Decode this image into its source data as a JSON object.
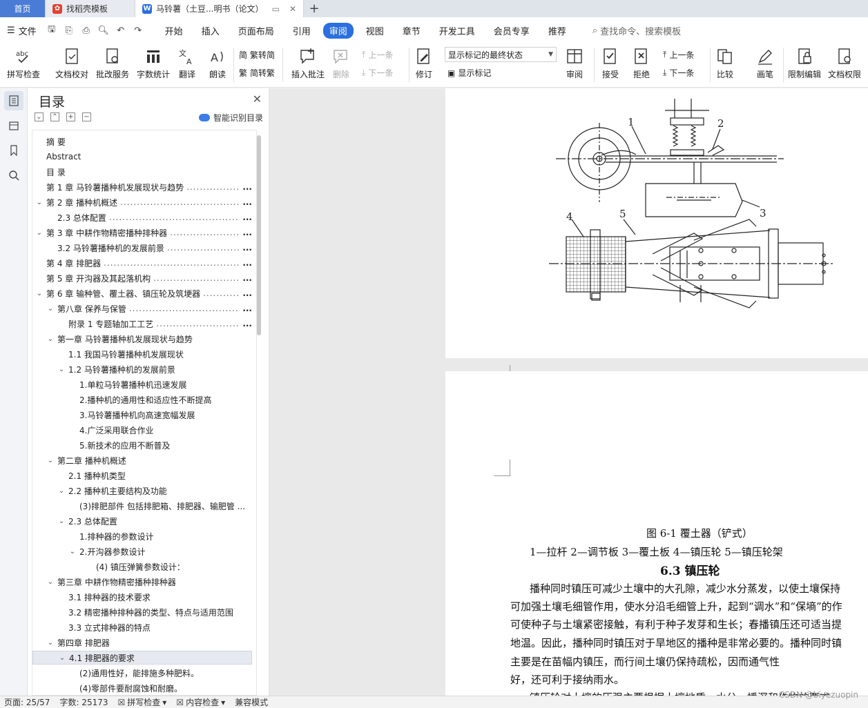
{
  "tabs": [
    {
      "label": "首页"
    },
    {
      "label": "找稻壳模板"
    },
    {
      "label": "马铃薯（土豆...明书（论文）"
    }
  ],
  "menu": {
    "file": "文件",
    "tabs": [
      "开始",
      "插入",
      "页面布局",
      "引用",
      "审阅",
      "视图",
      "章节",
      "开发工具",
      "会员专享",
      "推荐"
    ],
    "active": "审阅",
    "search": "查找命令、搜索模板"
  },
  "ribbon": {
    "spell": "拼写检查",
    "proof": "文档校对",
    "batch": "批改服务",
    "wordcount": "字数统计",
    "translate": "翻译",
    "read": "朗读",
    "trad": "繁转简",
    "simp": "简转繁",
    "insert_comment": "插入批注",
    "delete": "删除",
    "prev": "上一条",
    "next": "下一条",
    "revise": "修订",
    "markup_state": "显示标记的最终状态",
    "show_markup": "显示标记",
    "review": "审阅",
    "accept": "接受",
    "reject": "拒绝",
    "prev2": "上一条",
    "next2": "下一条",
    "compare": "比较",
    "pen": "画笔",
    "restrict": "限制编辑",
    "rights": "文档权限"
  },
  "toc": {
    "title": "目录",
    "smart": "智能识别目录",
    "items": [
      {
        "text": "摘    要"
      },
      {
        "text": "Abstract"
      },
      {
        "text": "目    录"
      },
      {
        "text": "第 1 章  马铃薯播种机发展现状与趋势",
        "end": "..."
      },
      {
        "text": "第 2 章  播种机概述",
        "end": "..."
      },
      {
        "text": "2.3    总体配置",
        "end": "..."
      },
      {
        "text": "第 3 章  中耕作物精密播种排种器",
        "end": "..."
      },
      {
        "text": "3.2    马铃薯播种机的发展前景",
        "end": "..."
      },
      {
        "text": "第 4 章  排肥器",
        "end": "..."
      },
      {
        "text": "第 5 章  开沟器及其起落机构",
        "end": "..."
      },
      {
        "text": "第 6 章  输种管、覆土器、镇压轮及筑埂器",
        "end": "..."
      },
      {
        "text": "第八章    保养与保管",
        "end": "..."
      },
      {
        "text": "附录 1 专题轴加工工艺",
        "end": "..."
      },
      {
        "text": "第一章    马铃薯播种机发展现状与趋势"
      },
      {
        "text": "1.1    我国马铃薯播种机发展现状"
      },
      {
        "text": "1.2    马铃薯播种机的发展前景"
      },
      {
        "text": "1.单粒马铃薯播种机迅速发展"
      },
      {
        "text": "2.播种机的通用性和适应性不断提高"
      },
      {
        "text": "3.马铃薯播种机向高速宽幅发展"
      },
      {
        "text": "4.广泛采用联合作业"
      },
      {
        "text": "5.新技术的应用不断普及"
      },
      {
        "text": "第二章    播种机概述"
      },
      {
        "text": "2.1  播种机类型"
      },
      {
        "text": "2.2  播种机主要结构及功能"
      },
      {
        "text": "(3)排肥部件    包括排肥箱、排肥器、输肥管 ..."
      },
      {
        "text": "2.3  总体配置"
      },
      {
        "text": "1.排种器的参数设计"
      },
      {
        "text": "2.开沟器参数设计"
      },
      {
        "text": "(4)  镇压弹簧参数设计："
      },
      {
        "text": "第三章       中耕作物精密播种排种器"
      },
      {
        "text": "3.1    排种器的技术要求"
      },
      {
        "text": "3.2    精密播种排种器的类型、特点与适用范围"
      },
      {
        "text": "3.3    立式排种器的特点"
      },
      {
        "text": "第四章       排肥器"
      },
      {
        "text": "4.1    排肥器的要求"
      },
      {
        "text": "(2)通用性好，能排施多种肥料。"
      },
      {
        "text": "(4)零部件要耐腐蚀和耐磨。"
      }
    ]
  },
  "figure": {
    "labels": [
      "1",
      "2",
      "3",
      "4",
      "5"
    ]
  },
  "doc": {
    "caption": "图 6-1    覆土器（铲式）",
    "legend": "1—拉杆    2—调节板    3—覆土板    4—镇压轮    5—镇压轮架",
    "heading": "6.3    镇压轮",
    "para": [
      "播种同时镇压可减少土壤中的大孔隙，减少水分蒸发，以使土壤保持",
      "可加强土壤毛细管作用，使水分沿毛细管上升，起到“调水”和“保墒”的作",
      "可使种子与土壤紧密接触，有利于种子发芽和生长；春播镇压还可适当提",
      "地温。因此，播种同时镇压对于旱地区的播种是非常必要的。播种同时镇",
      "主要是在苗幅内镇压，而行间土壤仍保持疏松，因而通气性",
      "好，还可利于接纳雨水。",
      "镇压轮对土壤的压强主要根据土壤地质、水分、播深和作物的要求"
    ]
  },
  "status": {
    "page": "页面: 25/57",
    "words": "字数: 25173",
    "spell": "拼写检查",
    "content": "内容检查",
    "compat": "兼容模式"
  },
  "watermark": "CSDN @biyezuopin",
  "colors": {
    "accent": "#2b6fe0",
    "home_tab": "#4a7cd6"
  }
}
